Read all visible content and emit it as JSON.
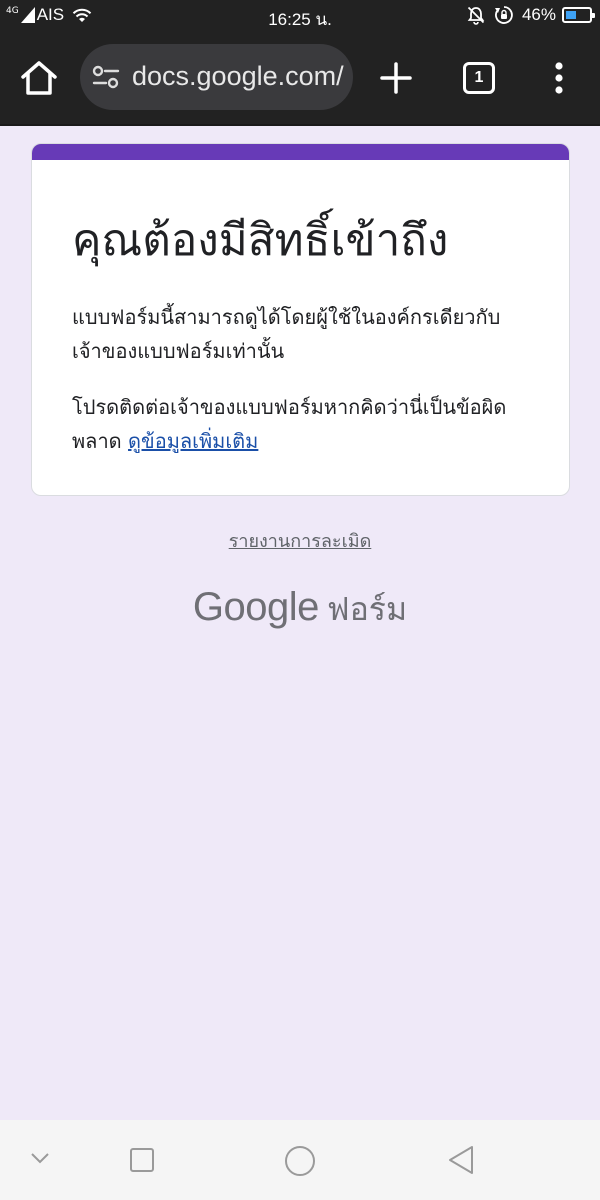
{
  "status_bar": {
    "network_type": "4G",
    "carrier": "AIS",
    "time": "16:25 น.",
    "battery_percent_text": "46%",
    "battery_level": 0.46
  },
  "browser": {
    "url": "docs.google.com/",
    "tab_count": "1"
  },
  "card": {
    "accent_color": "#673ab7",
    "title": "คุณต้องมีสิทธิ์เข้าถึง",
    "body_line1": "แบบฟอร์มนี้สามารถดูได้โดยผู้ใช้ในองค์กรเดียวกับเจ้าของแบบฟอร์มเท่านั้น",
    "body_line2": "โปรดติดต่อเจ้าของแบบฟอร์มหากคิดว่านี่เป็นข้อผิดพลาด",
    "learn_more": "ดูข้อมูลเพิ่มเติม"
  },
  "report_abuse": "รายงานการละเมิด",
  "footer": {
    "brand": "Google",
    "product": "ฟอร์ม"
  },
  "icons": {
    "home": "home-icon",
    "site_settings": "tune-icon",
    "new_tab": "plus-icon",
    "menu": "more-vert-icon",
    "nav_back": "triangle-back-icon",
    "nav_home": "circle-home-icon",
    "nav_recents": "square-recents-icon",
    "nav_collapse": "chevron-down-icon"
  }
}
